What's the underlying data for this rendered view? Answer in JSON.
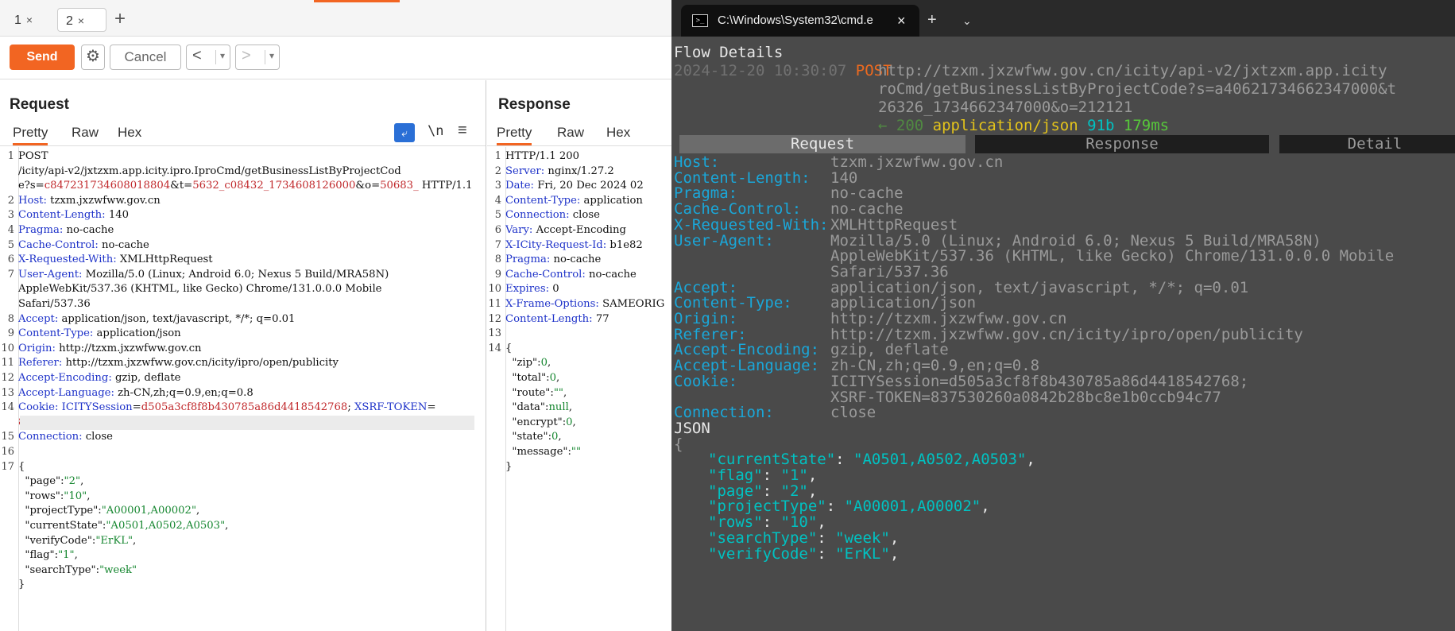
{
  "tabs": [
    {
      "label": "1",
      "close": "×"
    },
    {
      "label": "2",
      "close": "×"
    }
  ],
  "add_tab": "+",
  "toolbar": {
    "send": "Send",
    "cancel": "Cancel",
    "back": "<",
    "forward": ">",
    "dropdown": "▾"
  },
  "request": {
    "title": "Request",
    "tabs": [
      "Pretty",
      "Raw",
      "Hex"
    ],
    "icons": {
      "wrap": "wrap-icon",
      "newline": "\\n",
      "menu": "≡"
    },
    "lines": [
      {
        "n": "1",
        "segs": [
          {
            "t": "POST",
            "c": "hv"
          }
        ]
      },
      {
        "n": "",
        "segs": [
          {
            "t": "/icity/api-v2/jxtzxm.app.icity.ipro.IproCmd/getBusinessListByProjectCod",
            "c": "hv"
          }
        ]
      },
      {
        "n": "",
        "segs": [
          {
            "t": "e?s=",
            "c": "hv"
          },
          {
            "t": "c847231734608018804",
            "c": "red"
          },
          {
            "t": "&t=",
            "c": "hv"
          },
          {
            "t": "5632_c08432_1734608126000",
            "c": "red"
          },
          {
            "t": "&o=",
            "c": "hv"
          },
          {
            "t": "50683_",
            "c": "red"
          },
          {
            "t": " HTTP/1.1",
            "c": "hv"
          }
        ]
      },
      {
        "n": "2",
        "segs": [
          {
            "t": "Host: ",
            "c": "hn"
          },
          {
            "t": "tzxm.jxzwfww.gov.cn",
            "c": "hv"
          }
        ]
      },
      {
        "n": "3",
        "segs": [
          {
            "t": "Content-Length: ",
            "c": "hn"
          },
          {
            "t": "140",
            "c": "hv"
          }
        ]
      },
      {
        "n": "4",
        "segs": [
          {
            "t": "Pragma: ",
            "c": "hn"
          },
          {
            "t": "no-cache",
            "c": "hv"
          }
        ]
      },
      {
        "n": "5",
        "segs": [
          {
            "t": "Cache-Control: ",
            "c": "hn"
          },
          {
            "t": "no-cache",
            "c": "hv"
          }
        ]
      },
      {
        "n": "6",
        "segs": [
          {
            "t": "X-Requested-With: ",
            "c": "hn"
          },
          {
            "t": "XMLHttpRequest",
            "c": "hv"
          }
        ]
      },
      {
        "n": "7",
        "segs": [
          {
            "t": "User-Agent: ",
            "c": "hn"
          },
          {
            "t": "Mozilla/5.0 (Linux; Android 6.0; Nexus 5 Build/MRA58N)",
            "c": "hv"
          }
        ]
      },
      {
        "n": "",
        "segs": [
          {
            "t": "AppleWebKit/537.36 (KHTML, like Gecko) Chrome/131.0.0.0 Mobile",
            "c": "hv"
          }
        ]
      },
      {
        "n": "",
        "segs": [
          {
            "t": "Safari/537.36",
            "c": "hv"
          }
        ]
      },
      {
        "n": "8",
        "segs": [
          {
            "t": "Accept: ",
            "c": "hn"
          },
          {
            "t": "application/json, text/javascript, */*; q=0.01",
            "c": "hv"
          }
        ]
      },
      {
        "n": "9",
        "segs": [
          {
            "t": "Content-Type: ",
            "c": "hn"
          },
          {
            "t": "application/json",
            "c": "hv"
          }
        ]
      },
      {
        "n": "10",
        "segs": [
          {
            "t": "Origin: ",
            "c": "hn"
          },
          {
            "t": "http://tzxm.jxzwfww.gov.cn",
            "c": "hv"
          }
        ]
      },
      {
        "n": "11",
        "segs": [
          {
            "t": "Referer: ",
            "c": "hn"
          },
          {
            "t": "http://tzxm.jxzwfww.gov.cn/icity/ipro/open/publicity",
            "c": "hv"
          }
        ]
      },
      {
        "n": "12",
        "segs": [
          {
            "t": "Accept-Encoding: ",
            "c": "hn"
          },
          {
            "t": "gzip, deflate",
            "c": "hv"
          }
        ]
      },
      {
        "n": "13",
        "segs": [
          {
            "t": "Accept-Language: ",
            "c": "hn"
          },
          {
            "t": "zh-CN,zh;q=0.9,en;q=0.8",
            "c": "hv"
          }
        ]
      },
      {
        "n": "14",
        "segs": [
          {
            "t": "Cookie: ",
            "c": "hn"
          },
          {
            "t": "ICITYSession",
            "c": "hn"
          },
          {
            "t": "=",
            "c": "hv"
          },
          {
            "t": "d505a3cf8f8b430785a86d4418542768",
            "c": "red"
          },
          {
            "t": "; ",
            "c": "hv"
          },
          {
            "t": "XSRF-TOKEN",
            "c": "hn"
          },
          {
            "t": "=",
            "c": "hv"
          }
        ]
      },
      {
        "n": "",
        "segs": [
          {
            "t": "837530260a0842b28bc8e1b0ccb94c77",
            "c": "red"
          }
        ],
        "hl": true
      },
      {
        "n": "15",
        "segs": [
          {
            "t": "Connection: ",
            "c": "hn"
          },
          {
            "t": "close",
            "c": "hv"
          }
        ]
      },
      {
        "n": "16",
        "segs": []
      },
      {
        "n": "17",
        "segs": [
          {
            "t": "{",
            "c": "hv"
          }
        ]
      },
      {
        "n": "",
        "segs": [
          {
            "t": "  \"page\"",
            "c": "jk"
          },
          {
            "t": ":",
            "c": "hv"
          },
          {
            "t": "\"2\"",
            "c": "jv"
          },
          {
            "t": ",",
            "c": "hv"
          }
        ]
      },
      {
        "n": "",
        "segs": [
          {
            "t": "  \"rows\"",
            "c": "jk"
          },
          {
            "t": ":",
            "c": "hv"
          },
          {
            "t": "\"10\"",
            "c": "jv"
          },
          {
            "t": ",",
            "c": "hv"
          }
        ]
      },
      {
        "n": "",
        "segs": [
          {
            "t": "  \"projectType\"",
            "c": "jk"
          },
          {
            "t": ":",
            "c": "hv"
          },
          {
            "t": "\"A00001,A00002\"",
            "c": "jv"
          },
          {
            "t": ",",
            "c": "hv"
          }
        ]
      },
      {
        "n": "",
        "segs": [
          {
            "t": "  \"currentState\"",
            "c": "jk"
          },
          {
            "t": ":",
            "c": "hv"
          },
          {
            "t": "\"A0501,A0502,A0503\"",
            "c": "jv"
          },
          {
            "t": ",",
            "c": "hv"
          }
        ]
      },
      {
        "n": "",
        "segs": [
          {
            "t": "  \"verifyCode\"",
            "c": "jk"
          },
          {
            "t": ":",
            "c": "hv"
          },
          {
            "t": "\"ErKL\"",
            "c": "jv"
          },
          {
            "t": ",",
            "c": "hv"
          }
        ]
      },
      {
        "n": "",
        "segs": [
          {
            "t": "  \"flag\"",
            "c": "jk"
          },
          {
            "t": ":",
            "c": "hv"
          },
          {
            "t": "\"1\"",
            "c": "jv"
          },
          {
            "t": ",",
            "c": "hv"
          }
        ]
      },
      {
        "n": "",
        "segs": [
          {
            "t": "  \"searchType\"",
            "c": "jk"
          },
          {
            "t": ":",
            "c": "hv"
          },
          {
            "t": "\"week\"",
            "c": "jv"
          }
        ]
      },
      {
        "n": "",
        "segs": [
          {
            "t": "}",
            "c": "hv"
          }
        ]
      }
    ]
  },
  "response": {
    "title": "Response",
    "tabs": [
      "Pretty",
      "Raw",
      "Hex"
    ],
    "lines": [
      {
        "n": "1",
        "segs": [
          {
            "t": "HTTP/1.1 200",
            "c": "hv"
          }
        ]
      },
      {
        "n": "2",
        "segs": [
          {
            "t": "Server: ",
            "c": "hn"
          },
          {
            "t": "nginx/1.27.2",
            "c": "hv"
          }
        ]
      },
      {
        "n": "3",
        "segs": [
          {
            "t": "Date: ",
            "c": "hn"
          },
          {
            "t": "Fri, 20 Dec 2024 02",
            "c": "hv"
          }
        ]
      },
      {
        "n": "4",
        "segs": [
          {
            "t": "Content-Type: ",
            "c": "hn"
          },
          {
            "t": "application",
            "c": "hv"
          }
        ]
      },
      {
        "n": "5",
        "segs": [
          {
            "t": "Connection: ",
            "c": "hn"
          },
          {
            "t": "close",
            "c": "hv"
          }
        ]
      },
      {
        "n": "6",
        "segs": [
          {
            "t": "Vary: ",
            "c": "hn"
          },
          {
            "t": "Accept-Encoding",
            "c": "hv"
          }
        ]
      },
      {
        "n": "7",
        "segs": [
          {
            "t": "X-ICity-Request-Id: ",
            "c": "hn"
          },
          {
            "t": "b1e82",
            "c": "hv"
          }
        ]
      },
      {
        "n": "8",
        "segs": [
          {
            "t": "Pragma: ",
            "c": "hn"
          },
          {
            "t": "no-cache",
            "c": "hv"
          }
        ]
      },
      {
        "n": "9",
        "segs": [
          {
            "t": "Cache-Control: ",
            "c": "hn"
          },
          {
            "t": "no-cache",
            "c": "hv"
          }
        ]
      },
      {
        "n": "10",
        "segs": [
          {
            "t": "Expires: ",
            "c": "hn"
          },
          {
            "t": "0",
            "c": "hv"
          }
        ]
      },
      {
        "n": "11",
        "segs": [
          {
            "t": "X-Frame-Options: ",
            "c": "hn"
          },
          {
            "t": "SAMEORIG",
            "c": "hv"
          }
        ]
      },
      {
        "n": "12",
        "segs": [
          {
            "t": "Content-Length: ",
            "c": "hn"
          },
          {
            "t": "77",
            "c": "hv"
          }
        ]
      },
      {
        "n": "13",
        "segs": []
      },
      {
        "n": "14",
        "segs": [
          {
            "t": "{",
            "c": "hv"
          }
        ]
      },
      {
        "n": "",
        "segs": [
          {
            "t": "  \"zip\"",
            "c": "jk"
          },
          {
            "t": ":",
            "c": "hv"
          },
          {
            "t": "0",
            "c": "jv"
          },
          {
            "t": ",",
            "c": "hv"
          }
        ]
      },
      {
        "n": "",
        "segs": [
          {
            "t": "  \"total\"",
            "c": "jk"
          },
          {
            "t": ":",
            "c": "hv"
          },
          {
            "t": "0",
            "c": "jv"
          },
          {
            "t": ",",
            "c": "hv"
          }
        ]
      },
      {
        "n": "",
        "segs": [
          {
            "t": "  \"route\"",
            "c": "jk"
          },
          {
            "t": ":",
            "c": "hv"
          },
          {
            "t": "\"\"",
            "c": "jv"
          },
          {
            "t": ",",
            "c": "hv"
          }
        ]
      },
      {
        "n": "",
        "segs": [
          {
            "t": "  \"data\"",
            "c": "jk"
          },
          {
            "t": ":",
            "c": "hv"
          },
          {
            "t": "null",
            "c": "jv"
          },
          {
            "t": ",",
            "c": "hv"
          }
        ]
      },
      {
        "n": "",
        "segs": [
          {
            "t": "  \"encrypt\"",
            "c": "jk"
          },
          {
            "t": ":",
            "c": "hv"
          },
          {
            "t": "0",
            "c": "jv"
          },
          {
            "t": ",",
            "c": "hv"
          }
        ]
      },
      {
        "n": "",
        "segs": [
          {
            "t": "  \"state\"",
            "c": "jk"
          },
          {
            "t": ":",
            "c": "hv"
          },
          {
            "t": "0",
            "c": "jv"
          },
          {
            "t": ",",
            "c": "hv"
          }
        ]
      },
      {
        "n": "",
        "segs": [
          {
            "t": "  \"message\"",
            "c": "jk"
          },
          {
            "t": ":",
            "c": "hv"
          },
          {
            "t": "\"\"",
            "c": "jv"
          }
        ]
      },
      {
        "n": "",
        "segs": [
          {
            "t": "}",
            "c": "hv"
          }
        ]
      }
    ]
  },
  "terminal": {
    "tab_title": "C:\\Windows\\System32\\cmd.e",
    "close": "×",
    "add": "+",
    "dropdown": "⌄",
    "heading": "Flow Details",
    "flow": {
      "time": "2024-12-20 10:30:07",
      "method": "POST",
      "url_lines": [
        "http://tzxm.jxzwfww.gov.cn/icity/api-v2/jxtzxm.app.icity",
        "roCmd/getBusinessListByProjectCode?s=a40621734662347000&t",
        "26326_1734662347000&o=212121"
      ],
      "arrow": "←",
      "status": "200",
      "content_type": "application/json",
      "size": "91b",
      "duration": "179ms"
    },
    "section_tabs": [
      "Request",
      "Response",
      "Detail"
    ],
    "headers": [
      {
        "k": "Host:",
        "v": [
          "tzxm.jxzwfww.gov.cn"
        ]
      },
      {
        "k": "Content-Length:",
        "v": [
          "140"
        ]
      },
      {
        "k": "Pragma:",
        "v": [
          "no-cache"
        ]
      },
      {
        "k": "Cache-Control:",
        "v": [
          "no-cache"
        ]
      },
      {
        "k": "X-Requested-With:",
        "v": [
          "XMLHttpRequest"
        ]
      },
      {
        "k": "User-Agent:",
        "v": [
          "Mozilla/5.0 (Linux; Android 6.0; Nexus 5 Build/MRA58N)",
          "AppleWebKit/537.36 (KHTML, like Gecko) Chrome/131.0.0.0 Mobile",
          "Safari/537.36"
        ]
      },
      {
        "k": "Accept:",
        "v": [
          "application/json, text/javascript, */*; q=0.01"
        ]
      },
      {
        "k": "Content-Type:",
        "v": [
          "application/json"
        ]
      },
      {
        "k": "Origin:",
        "v": [
          "http://tzxm.jxzwfww.gov.cn"
        ]
      },
      {
        "k": "Referer:",
        "v": [
          "http://tzxm.jxzwfww.gov.cn/icity/ipro/open/publicity"
        ]
      },
      {
        "k": "Accept-Encoding:",
        "v": [
          "gzip, deflate"
        ]
      },
      {
        "k": "Accept-Language:",
        "v": [
          "zh-CN,zh;q=0.9,en;q=0.8"
        ]
      },
      {
        "k": "Cookie:",
        "v": [
          "ICITYSession=d505a3cf8f8b430785a86d4418542768;",
          "XSRF-TOKEN=837530260a0842b28bc8e1b0ccb94c77"
        ]
      },
      {
        "k": "Connection:",
        "v": [
          "close"
        ]
      }
    ],
    "json_label": "JSON",
    "json_open": "{",
    "json_body": [
      {
        "k": "\"currentState\"",
        "v": "\"A0501,A0502,A0503\""
      },
      {
        "k": "\"flag\"",
        "v": "\"1\""
      },
      {
        "k": "\"page\"",
        "v": "\"2\""
      },
      {
        "k": "\"projectType\"",
        "v": "\"A00001,A00002\""
      },
      {
        "k": "\"rows\"",
        "v": "\"10\""
      },
      {
        "k": "\"searchType\"",
        "v": "\"week\""
      },
      {
        "k": "\"verifyCode\"",
        "v": "\"ErKL\""
      }
    ]
  }
}
